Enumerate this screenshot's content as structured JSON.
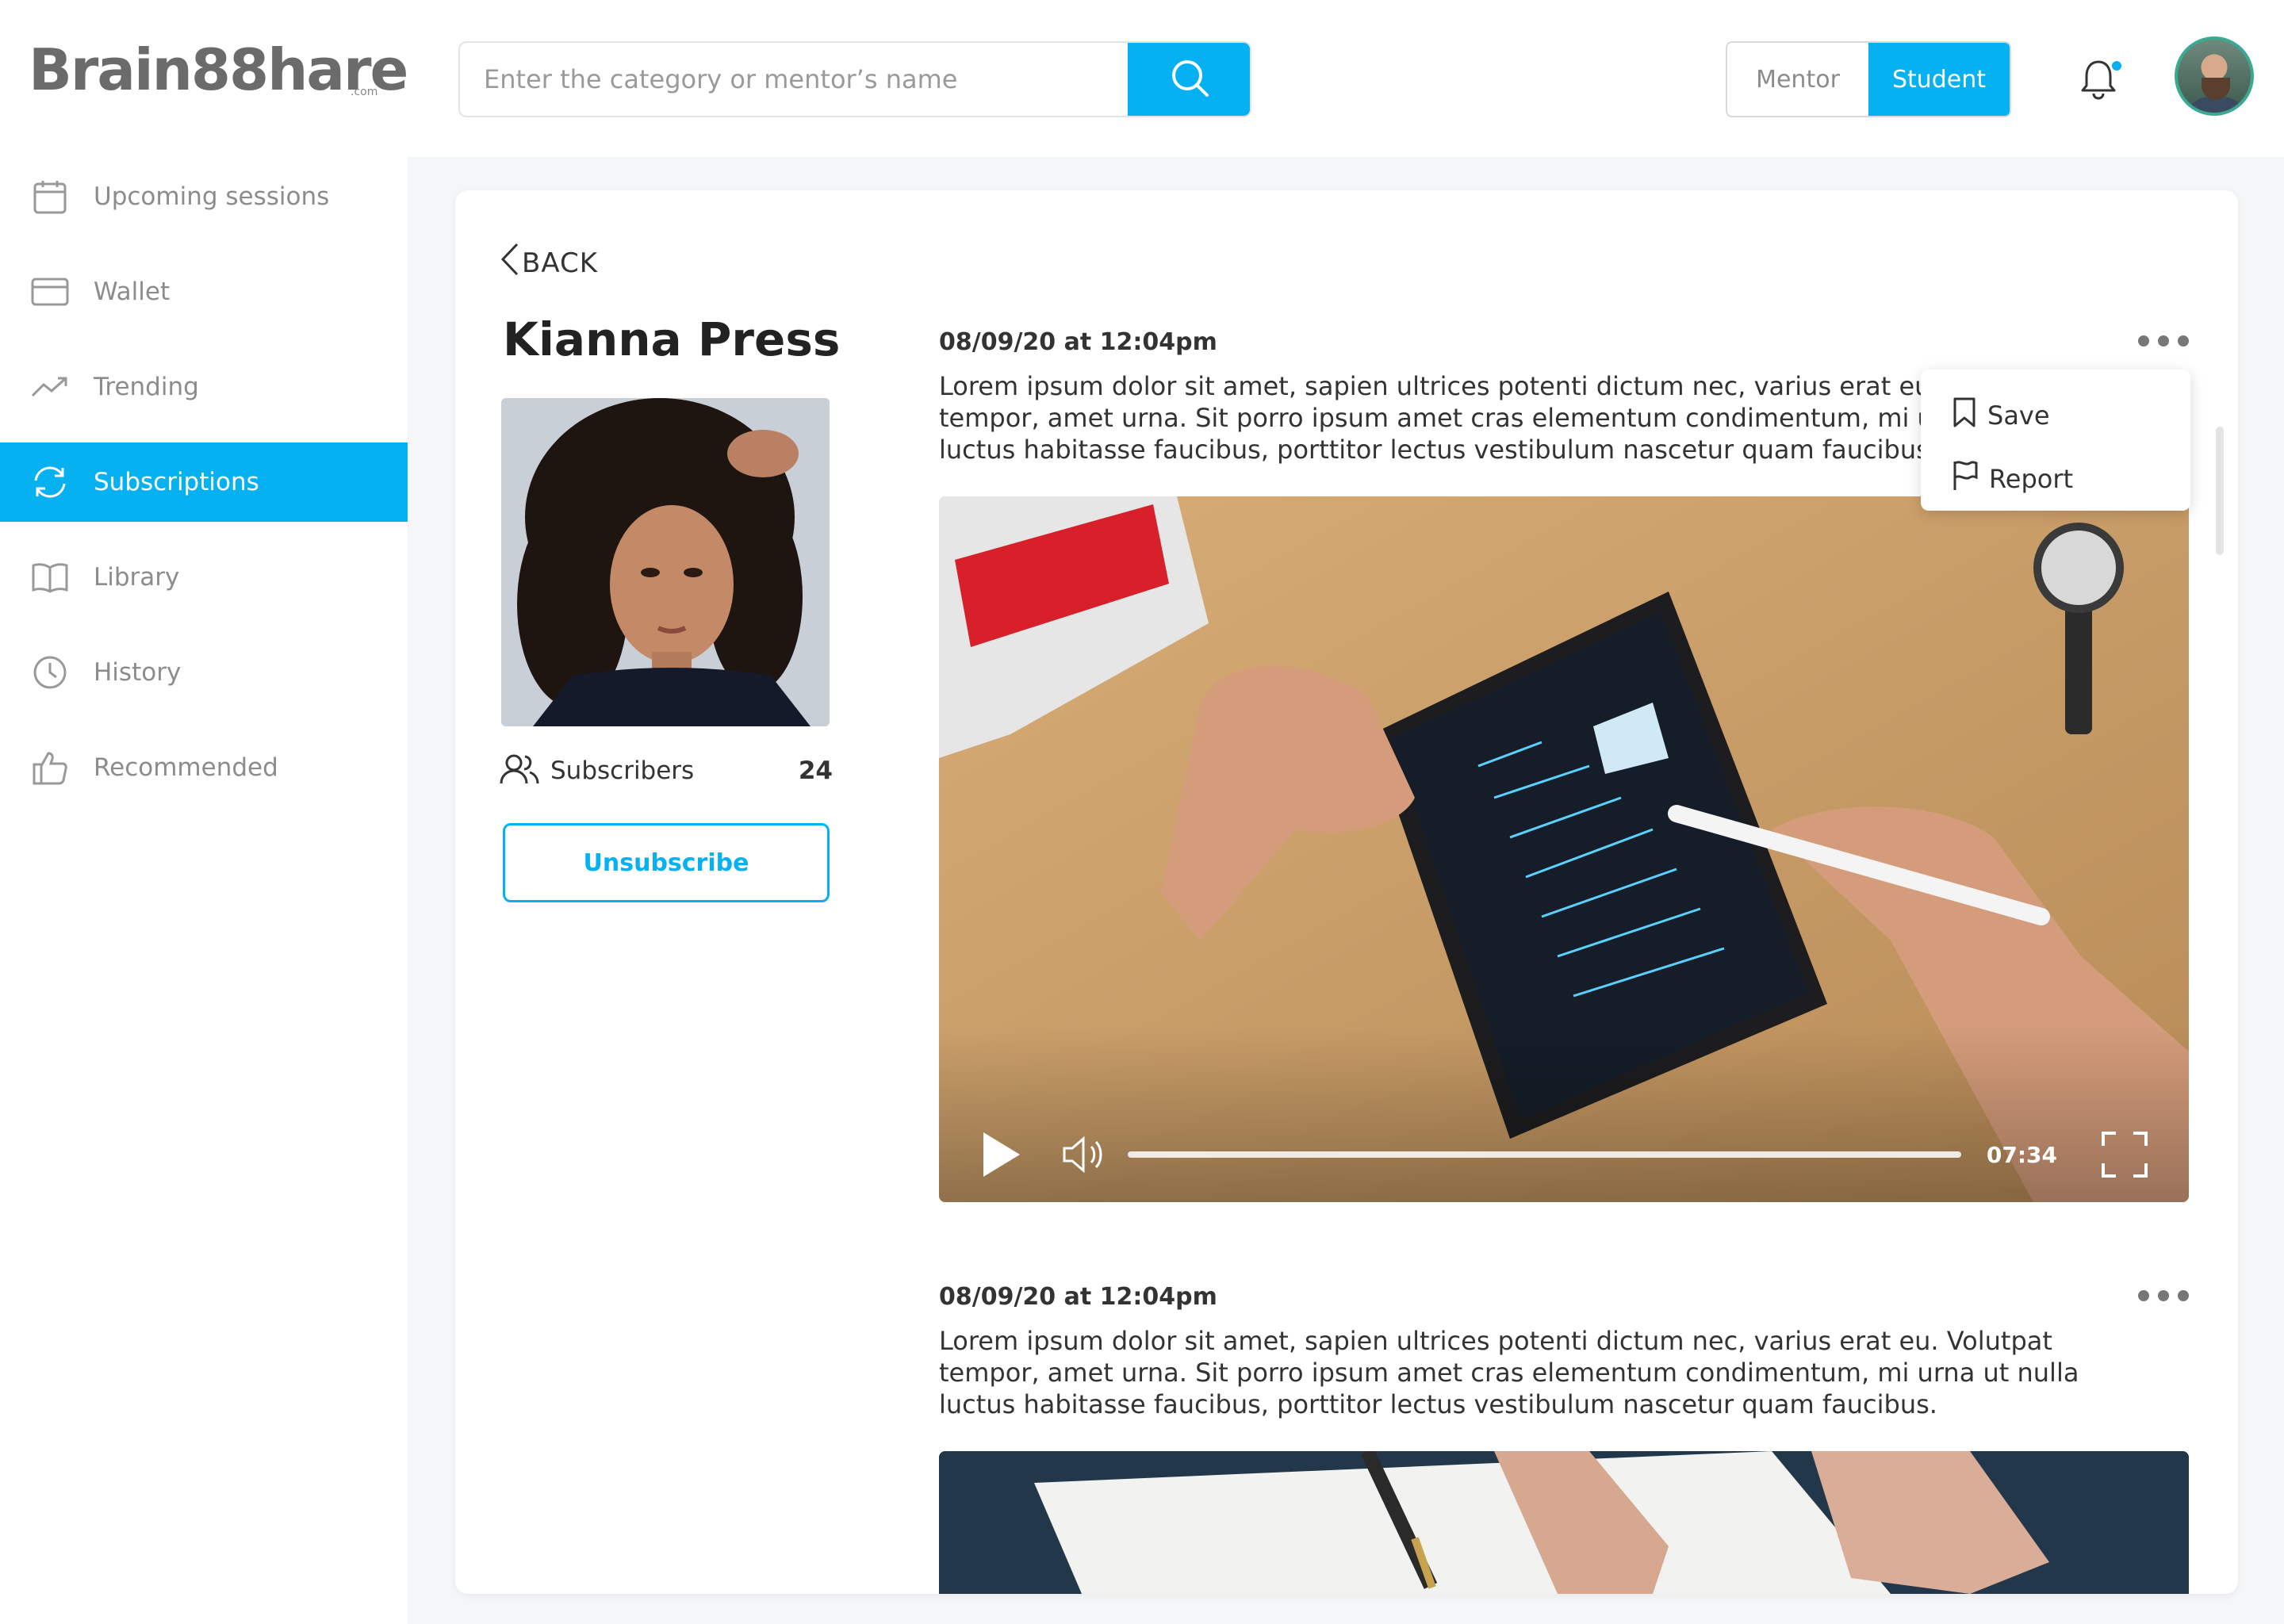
{
  "brand": {
    "logo_text": "Brain88hare",
    "logo_suffix": ".com"
  },
  "sidebar": {
    "items": [
      {
        "label": "Upcoming sessions",
        "icon": "calendar-icon"
      },
      {
        "label": "Wallet",
        "icon": "wallet-icon"
      },
      {
        "label": "Trending",
        "icon": "trending-icon"
      },
      {
        "label": "Subscriptions",
        "icon": "refresh-icon",
        "active": true
      },
      {
        "label": "Library",
        "icon": "book-icon"
      },
      {
        "label": "History",
        "icon": "clock-icon"
      },
      {
        "label": "Recommended",
        "icon": "thumbs-up-icon"
      }
    ]
  },
  "header": {
    "search_placeholder": "Enter the category or mentor’s name",
    "toggle": {
      "mentor": "Mentor",
      "student": "Student",
      "selected": "Student"
    }
  },
  "profile": {
    "back_label": "BACK",
    "name": "Kianna Press",
    "subscribers_label": "Subscribers",
    "subscribers_count": "24",
    "unsubscribe_label": "Unsubscribe"
  },
  "posts": [
    {
      "date": "08/09/20 at 12:04pm",
      "text": "Lorem ipsum dolor sit amet, sapien ultrices potenti dictum nec, varius erat eu. Volutpat tempor, amet urna. Sit porro ipsum amet cras elementum condimentum, mi urna ut nulla luctus habitasse faucibus, porttitor lectus vestibulum nascetur quam faucibus.",
      "video_time": "07:34"
    },
    {
      "date": "08/09/20 at 12:04pm",
      "text": "Lorem ipsum dolor sit amet, sapien ultrices potenti dictum nec, varius erat eu. Volutpat tempor, amet urna. Sit porro ipsum amet cras elementum condimentum, mi urna ut nulla luctus habitasse faucibus, porttitor lectus vestibulum nascetur quam faucibus."
    }
  ],
  "context_menu": {
    "save": "Save",
    "report": "Report"
  },
  "colors": {
    "accent": "#05b1f1",
    "text": "#333333",
    "muted": "#8c8c8c"
  }
}
